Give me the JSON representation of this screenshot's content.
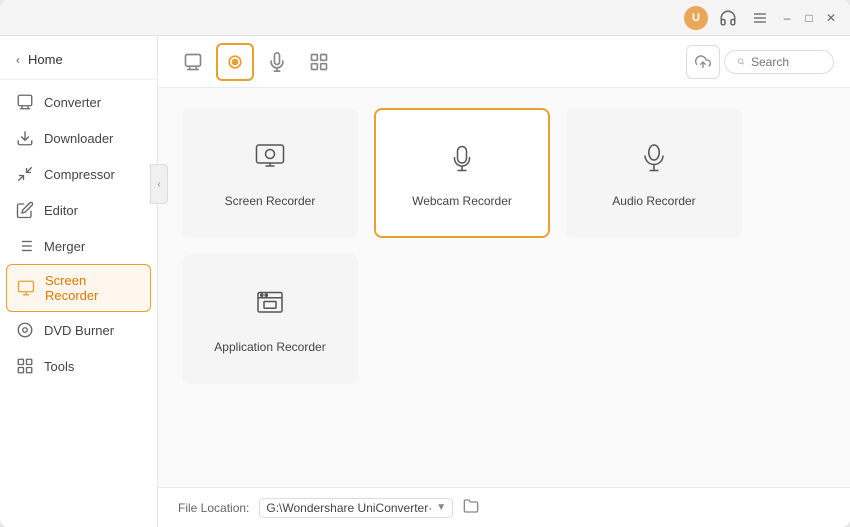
{
  "titleBar": {
    "avatarLabel": "U",
    "controls": [
      "hamburger",
      "minimize",
      "maximize",
      "close"
    ]
  },
  "sidebar": {
    "homeLabel": "Home",
    "items": [
      {
        "id": "converter",
        "label": "Converter",
        "active": false
      },
      {
        "id": "downloader",
        "label": "Downloader",
        "active": false
      },
      {
        "id": "compressor",
        "label": "Compressor",
        "active": false
      },
      {
        "id": "editor",
        "label": "Editor",
        "active": false
      },
      {
        "id": "merger",
        "label": "Merger",
        "active": false
      },
      {
        "id": "screen-recorder",
        "label": "Screen Recorder",
        "active": true
      },
      {
        "id": "dvd-burner",
        "label": "DVD Burner",
        "active": false
      },
      {
        "id": "tools",
        "label": "Tools",
        "active": false
      }
    ]
  },
  "toolbar": {
    "tabs": [
      {
        "id": "convert",
        "icon": "▣",
        "active": false
      },
      {
        "id": "record",
        "icon": "⏺",
        "active": true
      },
      {
        "id": "webcam",
        "icon": "🎙",
        "active": false
      },
      {
        "id": "apps",
        "icon": "⊞",
        "active": false
      }
    ],
    "searchPlaceholder": "Search"
  },
  "cards": {
    "rows": [
      [
        {
          "id": "screen-recorder",
          "label": "Screen Recorder",
          "active": false
        },
        {
          "id": "webcam-recorder",
          "label": "Webcam Recorder",
          "active": true
        },
        {
          "id": "audio-recorder",
          "label": "Audio Recorder",
          "active": false
        }
      ],
      [
        {
          "id": "application-recorder",
          "label": "Application Recorder",
          "active": false
        }
      ]
    ]
  },
  "bottomBar": {
    "locationLabel": "File Location:",
    "locationValue": "G:\\Wondershare UniConverter·",
    "folderIconLabel": "open folder"
  },
  "colors": {
    "accent": "#e8a030",
    "accentLight": "#fff7ed",
    "accentBorder": "#e8a030"
  }
}
